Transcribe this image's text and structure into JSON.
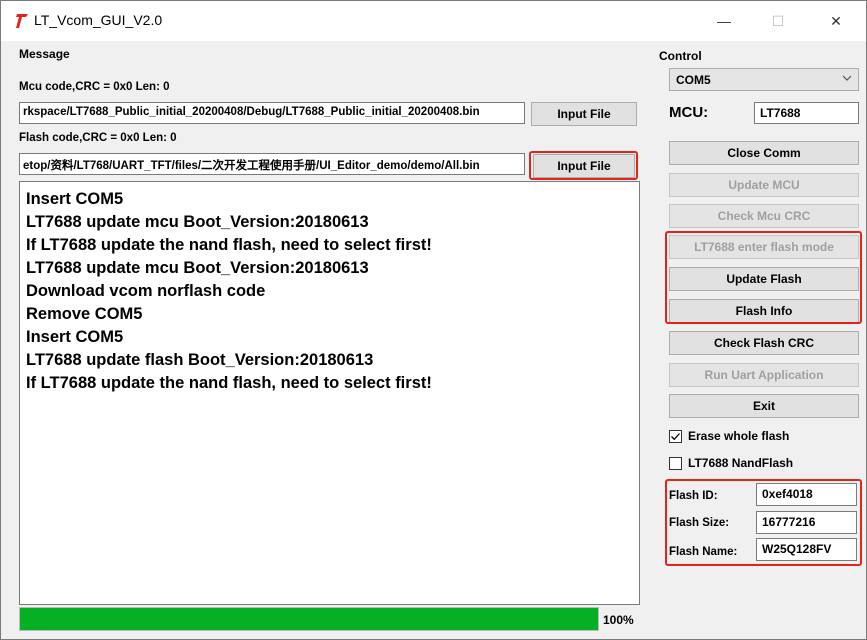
{
  "window": {
    "title": "LT_Vcom_GUI_V2.0",
    "minimize_glyph": "—",
    "maximize_glyph": "☐",
    "close_glyph": "✕",
    "icon": "lt-logo-icon"
  },
  "message": {
    "group_label": "Message",
    "mcu_code_label": "Mcu code,CRC = 0x0  Len: 0",
    "mcu_path": "rkspace/LT7688_Public_initial_20200408/Debug/LT7688_Public_initial_20200408.bin",
    "mcu_input_button": "Input File",
    "flash_code_label": "Flash code,CRC = 0x0  Len: 0",
    "flash_path": "etop/资料/LT768/UART_TFT/files/二次开发工程使用手册/UI_Editor_demo/demo/All.bin",
    "flash_input_button": "Input File",
    "log_lines": [
      "Insert COM5",
      "LT7688 update mcu Boot_Version:20180613",
      "If LT7688 update the nand flash, need to select first!",
      "LT7688 update mcu Boot_Version:20180613",
      "Download vcom norflash code",
      "Remove COM5",
      "Insert COM5",
      "LT7688 update flash Boot_Version:20180613",
      "If LT7688 update the nand flash, need to select first!"
    ],
    "progress_percent": 100,
    "progress_text": "100%"
  },
  "control": {
    "group_label": "Control",
    "port": "COM5",
    "mcu_label": "MCU:",
    "mcu_value": "LT7688",
    "buttons": {
      "close_comm": "Close Comm",
      "update_mcu": "Update MCU",
      "check_mcu_crc": "Check Mcu CRC",
      "enter_flash_mode": "LT7688 enter flash mode",
      "update_flash": "Update Flash",
      "flash_info": "Flash Info",
      "check_flash_crc": "Check Flash CRC",
      "run_uart_app": "Run Uart Application",
      "exit": "Exit"
    },
    "erase_whole_flash": {
      "label": "Erase whole flash",
      "checked": true
    },
    "nand_flash": {
      "label": "LT7688 NandFlash",
      "checked": false
    },
    "flash_id_label": "Flash ID:",
    "flash_id": "0xef4018",
    "flash_size_label": "Flash Size:",
    "flash_size": "16777216",
    "flash_name_label": "Flash Name:",
    "flash_name": "W25Q128FV"
  },
  "colors": {
    "highlight": "#e3241b",
    "progress": "#06b025",
    "disabled_text": "#a0a0a0"
  }
}
